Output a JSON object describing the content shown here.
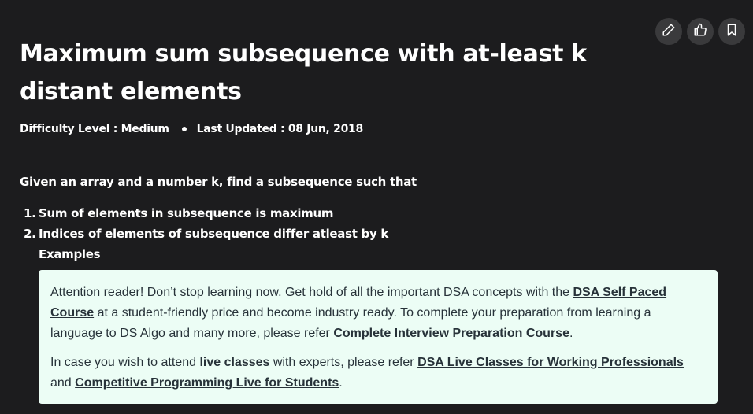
{
  "actions": {
    "edit_icon": "pencil-icon",
    "like_icon": "thumbs-up-icon",
    "bookmark_icon": "bookmark-icon"
  },
  "article": {
    "title": "Maximum sum subsequence with at-least k distant elements",
    "difficulty": "Difficulty Level : Medium",
    "updated": "Last Updated : 08 Jun, 2018",
    "intro": "Given an array and a number k, find a subsequence such that",
    "list": [
      {
        "num": "1.",
        "text": "Sum of elements in subsequence is maximum"
      },
      {
        "num": "2.",
        "text": "Indices of elements of subsequence differ atleast by k"
      }
    ],
    "examples_label": "Examples"
  },
  "callout": {
    "p1_a": "Attention reader! Don’t stop learning now. Get hold of all the important DSA concepts with the ",
    "p1_link1": "DSA Self Paced Course",
    "p1_b": " at a student-friendly price and become industry ready.  To complete your preparation from learning a language to DS Algo and many more,  please refer ",
    "p1_link2": "Complete Interview Preparation Course",
    "p1_c": ".",
    "p2_a": "In case you wish to attend ",
    "p2_bold": "live classes",
    "p2_b": " with experts, please refer ",
    "p2_link1": "DSA Live Classes for Working Professionals ",
    "p2_c": "and ",
    "p2_link2": "Competitive Programming Live for Students",
    "p2_d": "."
  },
  "colors": {
    "background": "#1c1c1e",
    "callout_bg": "#ecfdf5",
    "callout_text": "#273239"
  }
}
